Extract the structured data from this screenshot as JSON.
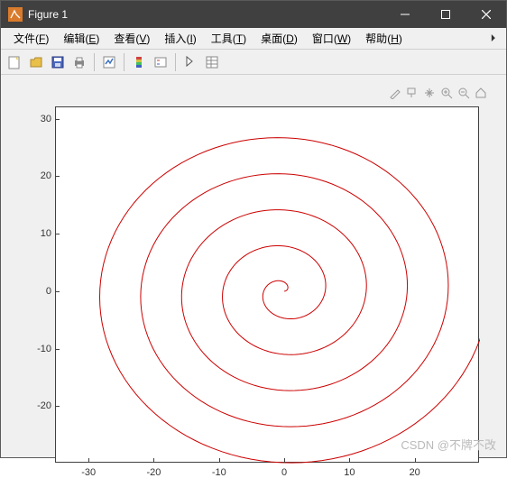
{
  "window": {
    "title": "Figure 1"
  },
  "menu": {
    "file": {
      "label": "文件",
      "key": "F"
    },
    "edit": {
      "label": "编辑",
      "key": "E"
    },
    "view": {
      "label": "查看",
      "key": "V"
    },
    "insert": {
      "label": "插入",
      "key": "I"
    },
    "tools": {
      "label": "工具",
      "key": "T"
    },
    "desktop": {
      "label": "桌面",
      "key": "D"
    },
    "windowm": {
      "label": "窗口",
      "key": "W"
    },
    "help": {
      "label": "帮助",
      "key": "H"
    }
  },
  "toolbar": {
    "new": "new-figure",
    "open": "open",
    "save": "save",
    "print": "print",
    "linkdata": "link-data",
    "colorbar": "insert-colorbar",
    "legend": "insert-legend",
    "edit": "edit-plot",
    "openprop": "open-property-inspector"
  },
  "axestools": [
    "brush",
    "datatip",
    "pan",
    "zoom-in",
    "zoom-out",
    "home"
  ],
  "watermark": "CSDN @不牌不改",
  "chart_data": {
    "type": "line",
    "title": "",
    "xlabel": "",
    "ylabel": "",
    "xlim": [
      -35,
      30
    ],
    "ylim": [
      -30,
      32
    ],
    "xticks": [
      -30,
      -20,
      -10,
      0,
      10,
      20
    ],
    "yticks": [
      -20,
      -10,
      0,
      10,
      20,
      30
    ],
    "series": [
      {
        "name": "spiral",
        "color": "#cc0000",
        "description": "Archimedean spiral r = a*theta, plotted as x=r cos(theta), y=r sin(theta), theta from 0 to ~10π, a≈1",
        "parametric": {
          "a": 1.0,
          "theta_start": 0,
          "theta_end": 31.4,
          "n_points": 600
        }
      }
    ]
  }
}
